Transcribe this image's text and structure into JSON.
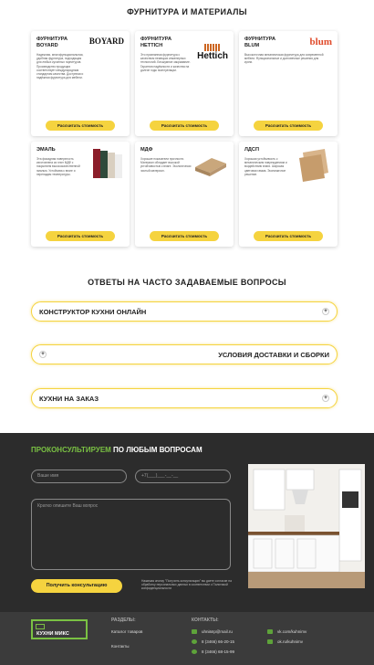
{
  "materials": {
    "title": "ФУРНИТУРА И МАТЕРИАЛЫ",
    "cards": [
      {
        "cat": "ФУРНИТУРА BOYARD",
        "logo": "BOYARD",
        "desc": "Надежная, многофункциональная, удобная фурнитура, подходящая для любых кухонных гарнитуров. Производство продукции соответствует международным стандартам качества. Доступная и надёжная фурнитура для мебели.",
        "btn": "Рассчитать стоимость"
      },
      {
        "cat": "ФУРНИТУРА HETTICH",
        "logo": "Hettich",
        "desc": "Это признанная фурнитура с качеством немецких инженерных технологий. Бесшумное закрывание. Гарантия надёжности и качества на долгие годы эксплуатации.",
        "btn": "Рассчитать стоимость"
      },
      {
        "cat": "ФУРНИТУРА BLUM",
        "logo": "blum",
        "desc": "Высокоточная механическая фурнитура для современной мебели. Функциональные и долговечные решения для кухни.",
        "btn": "Рассчитать стоимость"
      },
      {
        "cat": "ЭМАЛЬ",
        "desc": "Эта фасадная поверхность изготовлена из плит МДФ с покрытием высококачественной эмалью. Устойчива к влаге и перепадам температуры.",
        "btn": "Рассчитать стоимость"
      },
      {
        "cat": "МДФ",
        "desc": "Хорошие показатели прочности. Материал обладает высокой устойчивостью к влаге. Экологически чистый материал.",
        "btn": "Рассчитать стоимость"
      },
      {
        "cat": "ЛДСП",
        "desc": "Хорошая устойчивость к механическим повреждениям и воздействию влаги. Широкая цветовая гамма. Экономичное решение.",
        "btn": "Рассчитать стоимость"
      }
    ]
  },
  "faq": {
    "title": "ОТВЕТЫ НА ЧАСТО ЗАДАВАЕМЫЕ ВОПРОСЫ",
    "items": [
      "КОНСТРУКТОР КУХНИ ОНЛАЙН",
      "УСЛОВИЯ ДОСТАВКИ И СБОРКИ",
      "КУХНИ НА ЗАКАЗ"
    ]
  },
  "consult": {
    "title_accent": "ПРОКОНСУЛЬТИРУЕМ",
    "title_rest": " ПО ЛЮБЫМ ВОПРОСАМ",
    "name_placeholder": "Ваше имя",
    "phone_placeholder": "+7(___)___-__-__",
    "question_placeholder": "Кратко опишите Ваш вопрос",
    "button": "Получить консультацию",
    "agree": "Нажимая кнопку \"Получить консультацию\" вы даете согласие на обработку персональных данных в соответствии с Политикой конфиденциальности"
  },
  "footer": {
    "logo": "КУХНИ МИКС",
    "sections_title": "РАЗДЕЛЫ:",
    "links": [
      "Каталог товаров",
      "Контакты"
    ],
    "contacts_title": "КОНТАКТЫ:",
    "email": "uhniвпр@mail.ru",
    "phone1": "8 (3466) 66-20-15",
    "phone2": "8 (3466) 68-15-99",
    "vk": "vk.com/kuhnimv",
    "ok": "ok.ru/kuhnimv"
  },
  "colors": {
    "accent": "#f5d33f",
    "green": "#7ac143",
    "dark": "#2c2c2c"
  }
}
